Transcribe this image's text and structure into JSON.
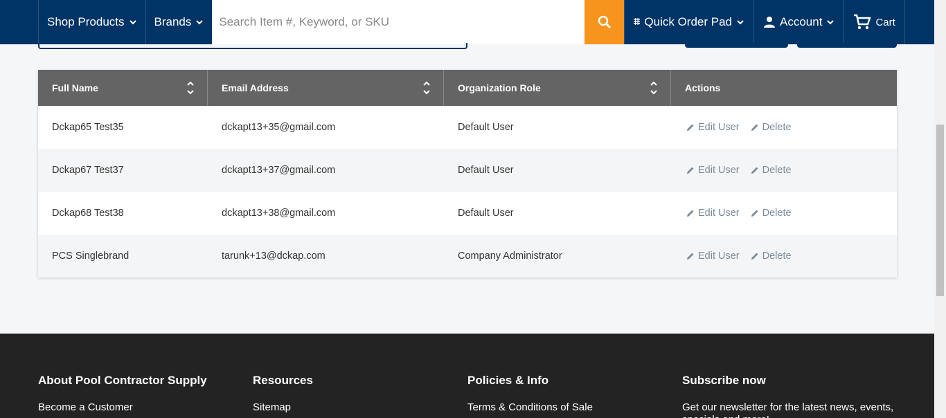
{
  "header": {
    "shop_products": "Shop Products",
    "brands": "Brands",
    "search_placeholder": "Search Item #, Keyword, or SKU",
    "quick_order_pad": "Quick Order Pad",
    "account": "Account",
    "cart": "Cart"
  },
  "table": {
    "columns": [
      "Full Name",
      "Email Address",
      "Organization Role",
      "Actions"
    ],
    "rows": [
      {
        "name": "Dckap65 Test35",
        "email": "dckapt13+35@gmail.com",
        "role": "Default User"
      },
      {
        "name": "Dckap67 Test37",
        "email": "dckapt13+37@gmail.com",
        "role": "Default User"
      },
      {
        "name": "Dckap68 Test38",
        "email": "dckapt13+38@gmail.com",
        "role": "Default User"
      },
      {
        "name": "PCS Singlebrand",
        "email": "tarunk+13@dckap.com",
        "role": "Company Administrator"
      }
    ],
    "edit_label": "Edit User",
    "delete_label": "Delete"
  },
  "footer": {
    "about_title": "About Pool Contractor Supply",
    "about_link": "Become a Customer",
    "resources_title": "Resources",
    "resources_link": "Sitemap",
    "policies_title": "Policies & Info",
    "policies_link": "Terms & Conditions of Sale",
    "subscribe_title": "Subscribe now",
    "subscribe_text": "Get our newsletter for the latest news, events, specials and more!"
  },
  "colors": {
    "header_bg": "#003366",
    "search_button": "#f7941d",
    "table_header": "#646464",
    "footer_bg": "#232323",
    "action_link": "#7a8a9a"
  }
}
